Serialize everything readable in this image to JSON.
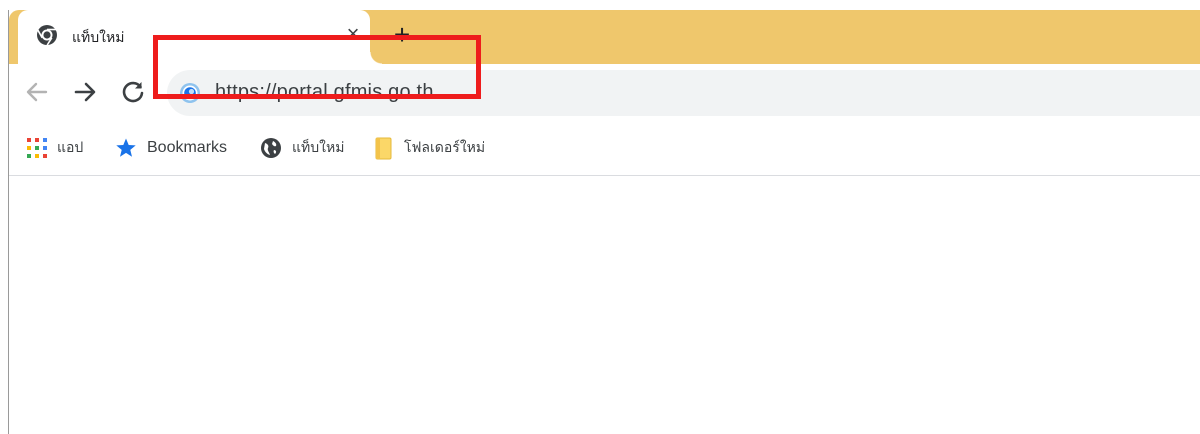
{
  "tab": {
    "title": "แท็บใหม่",
    "close_glyph": "×",
    "favicon": "chrome-icon"
  },
  "new_tab_glyph": "+",
  "toolbar": {
    "back_icon": "arrow-left-icon",
    "forward_icon": "arrow-right-icon",
    "reload_icon": "reload-icon",
    "url": "https://portal.gfmis.go.th"
  },
  "bookmarks": [
    {
      "label": "แอป",
      "icon": "apps-grid-icon"
    },
    {
      "label": "Bookmarks",
      "icon": "star-icon"
    },
    {
      "label": "แท็บใหม่",
      "icon": "globe-icon"
    },
    {
      "label": "โฟลเดอร์ใหม่",
      "icon": "folder-icon"
    }
  ],
  "colors": {
    "tabstrip": "#efc76c",
    "highlight": "#ee1c1c",
    "star": "#1a73e8"
  }
}
